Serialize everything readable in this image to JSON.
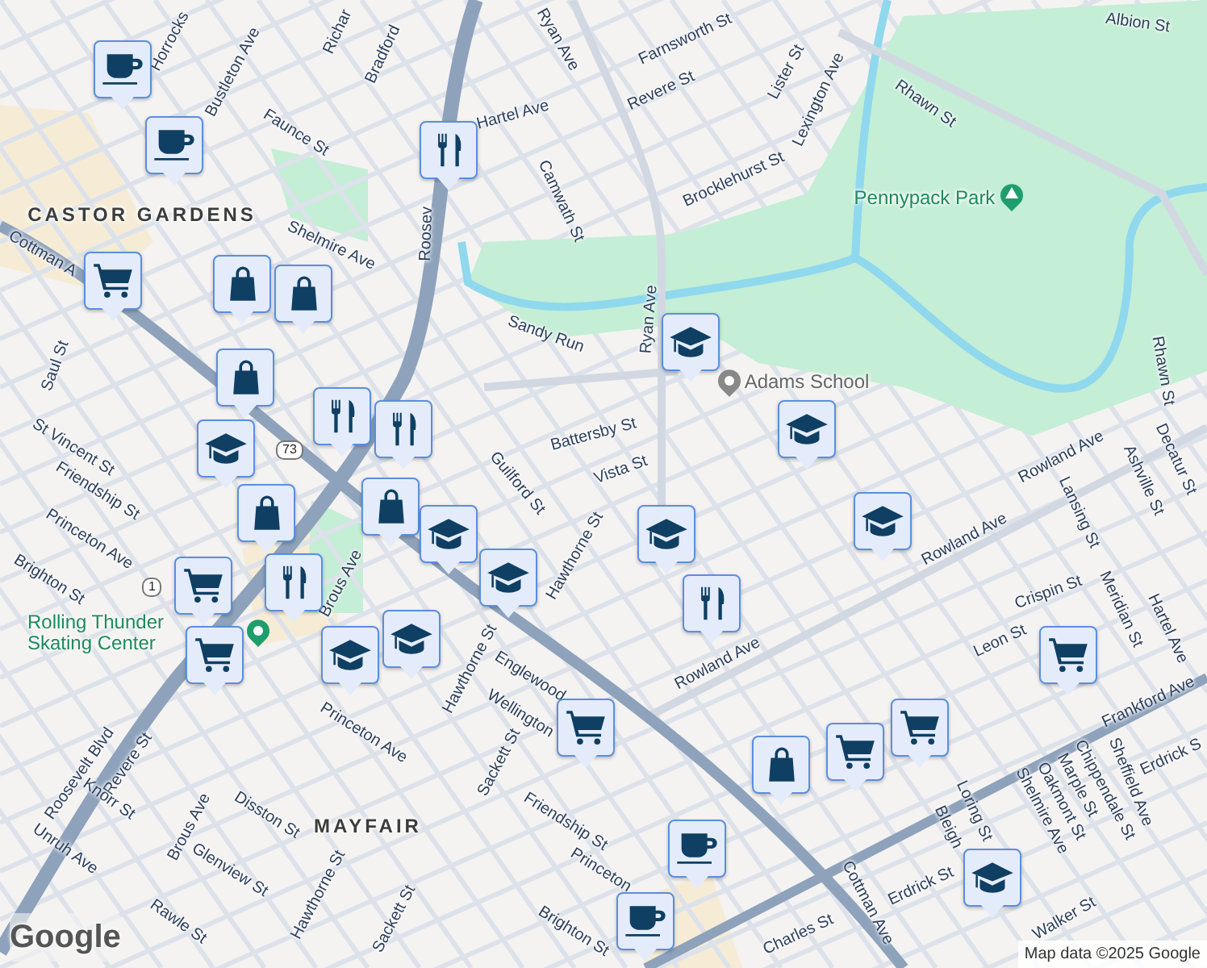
{
  "map": {
    "area_labels": [
      "CASTOR GARDENS",
      "MAYFAIR"
    ],
    "poi_labels": [
      "Pennypack Park",
      "Adams School",
      "Rolling Thunder Skating Center"
    ],
    "street_labels": [
      "Horrocks",
      "Bustleton Ave",
      "Richar",
      "Bradford",
      "Faunce St",
      "Roosev",
      "Ryan Ave",
      "Farnsworth St",
      "Hartel Ave",
      "Revere St",
      "Lister St",
      "Lexington Ave",
      "Camwath St",
      "Brocklehurst St",
      "Rhawn St",
      "Albion St",
      "Shelmire Ave",
      "Sandy Run",
      "Ryan Ave",
      "Rhawn St",
      "Battersby St",
      "Vista St",
      "Guilford St",
      "Hawthorne St",
      "Rowland Ave",
      "Rowland Ave",
      "Lansing St",
      "Ashville St",
      "Decatur St",
      "Crispin St",
      "Leon St",
      "Meridian St",
      "Hartel Ave",
      "Frankford Ave",
      "Sheffield Ave",
      "Erdrick S",
      "Rowland Ave",
      "Cottman A",
      "St Vincent St",
      "Friendship St",
      "Princeton Ave",
      "Brighton St",
      "Brous Ave",
      "Roosevelt Blvd",
      "Princeton Ave",
      "Hawthorne St",
      "Englewood",
      "Wellington",
      "Sackett St",
      "Friendship St",
      "Disston St",
      "Glenview St",
      "Brous Ave",
      "Revere St",
      "Knorr St",
      "Unruh Ave",
      "Rawle St",
      "Hawthorne St",
      "Sackett St",
      "Princeton",
      "Brighton St",
      "Charles St",
      "Cottman Ave",
      "Erdrick St",
      "Loring St",
      "Bleigh",
      "Shelmire Ave",
      "Oakmont St",
      "Marple St",
      "Chippendale St",
      "Walker St",
      "Saul St"
    ],
    "route_shields": [
      "73",
      "1"
    ],
    "markers": [
      {
        "kind": "cafe"
      },
      {
        "kind": "cafe"
      },
      {
        "kind": "restaurant"
      },
      {
        "kind": "cart"
      },
      {
        "kind": "bag"
      },
      {
        "kind": "bag"
      },
      {
        "kind": "bag"
      },
      {
        "kind": "restaurant"
      },
      {
        "kind": "restaurant"
      },
      {
        "kind": "school"
      },
      {
        "kind": "bag"
      },
      {
        "kind": "bag"
      },
      {
        "kind": "restaurant"
      },
      {
        "kind": "school"
      },
      {
        "kind": "school"
      },
      {
        "kind": "cart"
      },
      {
        "kind": "cart"
      },
      {
        "kind": "school"
      },
      {
        "kind": "school"
      },
      {
        "kind": "school"
      },
      {
        "kind": "school"
      },
      {
        "kind": "school"
      },
      {
        "kind": "restaurant"
      },
      {
        "kind": "school"
      },
      {
        "kind": "cart"
      },
      {
        "kind": "cart"
      },
      {
        "kind": "bag"
      },
      {
        "kind": "cart"
      },
      {
        "kind": "cart"
      },
      {
        "kind": "cafe"
      },
      {
        "kind": "cafe"
      },
      {
        "kind": "school"
      }
    ]
  },
  "footer": {
    "logo": "Google",
    "attribution": "Map data ©2025 Google"
  }
}
